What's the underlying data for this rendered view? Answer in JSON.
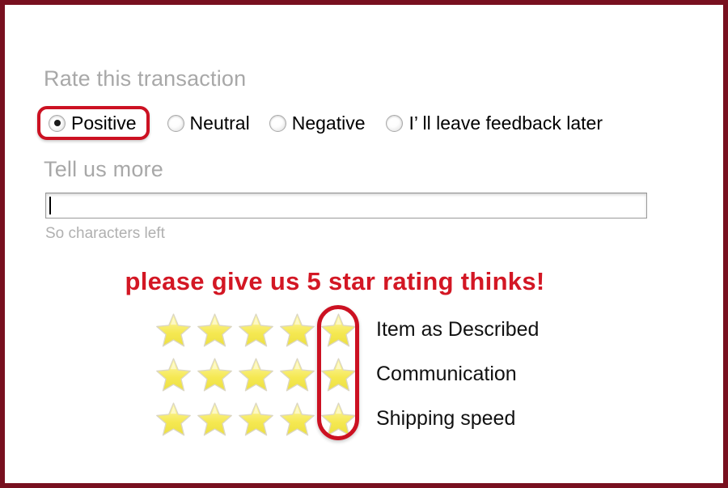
{
  "frame": {
    "border_color": "#78101f",
    "background": "#ffffff"
  },
  "rate_section": {
    "heading": "Rate this transaction",
    "selected_value": "Positive",
    "options": [
      {
        "label": "Positive",
        "checked": true,
        "highlighted": true
      },
      {
        "label": "Neutral",
        "checked": false,
        "highlighted": false
      },
      {
        "label": "Negative",
        "checked": false,
        "highlighted": false
      },
      {
        "label": "I’  ll leave feedback later",
        "checked": false,
        "highlighted": false
      }
    ]
  },
  "tell_us_more": {
    "heading": "Tell us more",
    "input_value": "",
    "input_placeholder": "",
    "characters_left": "So characters left"
  },
  "promo": {
    "text": "please give us 5 star rating thinks!",
    "color": "#d31724"
  },
  "ratings": {
    "max_stars": 5,
    "highlight_column": 5,
    "highlight_color": "#cc1122",
    "star_color": "#f6ee5a",
    "rows": [
      {
        "label": "Item as Described",
        "value": 5
      },
      {
        "label": "Communication",
        "value": 5
      },
      {
        "label": "Shipping speed",
        "value": 5
      }
    ]
  },
  "icons": {
    "star": "star-icon",
    "radio": "radio-button-icon",
    "caret": "text-caret-icon"
  }
}
